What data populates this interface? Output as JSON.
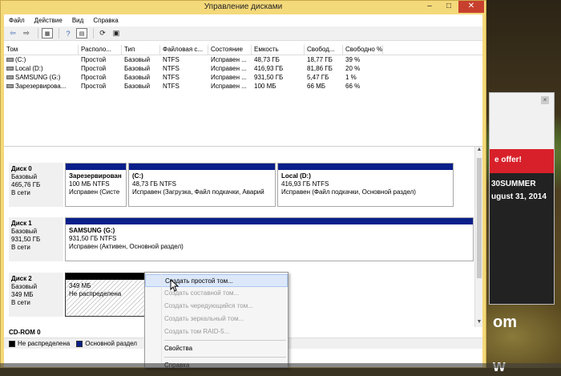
{
  "window": {
    "title": "Управление дисками",
    "min": "–",
    "max": "□",
    "close": "✕"
  },
  "menu": [
    "Файл",
    "Действие",
    "Вид",
    "Справка"
  ],
  "toolbar": [
    "back-icon",
    "forward-icon",
    "grid-icon",
    "help-icon",
    "properties-icon",
    "refresh-icon",
    "export-icon"
  ],
  "volumes": {
    "headers": [
      "Том",
      "Располо...",
      "Тип",
      "Файловая с...",
      "Состояние",
      "Емкость",
      "Свобод...",
      "Свободно %"
    ],
    "rows": [
      [
        "(C:)",
        "Простой",
        "Базовый",
        "NTFS",
        "Исправен ...",
        "48,73 ГБ",
        "18,77 ГБ",
        "39 %"
      ],
      [
        "Local (D:)",
        "Простой",
        "Базовый",
        "NTFS",
        "Исправен ...",
        "416,93 ГБ",
        "81,86 ГБ",
        "20 %"
      ],
      [
        "SAMSUNG (G:)",
        "Простой",
        "Базовый",
        "NTFS",
        "Исправен ...",
        "931,50 ГБ",
        "5,47 ГБ",
        "1 %"
      ],
      [
        "Зарезервирова...",
        "Простой",
        "Базовый",
        "NTFS",
        "Исправен ...",
        "100 МБ",
        "66 МБ",
        "66 %"
      ]
    ]
  },
  "disks": [
    {
      "name": "Диск 0",
      "type": "Базовый",
      "size": "465,76 ГБ",
      "status": "В сети",
      "parts": [
        {
          "name": "Зарезервирован",
          "size": "100 МБ NTFS",
          "state": "Исправен (Систе"
        },
        {
          "name": "(C:)",
          "size": "48,73 ГБ NTFS",
          "state": "Исправен (Загрузка, Файл подкачки, Аварий"
        },
        {
          "name": "Local  (D:)",
          "size": "416,93 ГБ NTFS",
          "state": "Исправен (Файл подкачки, Основной раздел)"
        }
      ]
    },
    {
      "name": "Диск 1",
      "type": "Базовый",
      "size": "931,50 ГБ",
      "status": "В сети",
      "parts": [
        {
          "name": "SAMSUNG  (G:)",
          "size": "931,50 ГБ NTFS",
          "state": "Исправен (Активен, Основной раздел)"
        }
      ]
    },
    {
      "name": "Диск 2",
      "type": "Базовый",
      "size": "349 МБ",
      "status": "В сети",
      "parts": [
        {
          "name": "349 МБ",
          "state": "Не распределена"
        }
      ]
    }
  ],
  "cdrom": "CD-ROM 0",
  "legend": [
    {
      "label": "Не распределена",
      "color": "#000000"
    },
    {
      "label": "Основной раздел",
      "color": "#0a1f8a"
    }
  ],
  "context_menu": [
    {
      "label": "Создать простой том...",
      "enabled": true,
      "highlighted": true
    },
    {
      "label": "Создать составной том...",
      "enabled": false
    },
    {
      "label": "Создать чередующийся том...",
      "enabled": false
    },
    {
      "label": "Создать зеркальный том...",
      "enabled": false
    },
    {
      "label": "Создать том RAID-5...",
      "enabled": false
    },
    {
      "label": "Свойства",
      "enabled": true
    },
    {
      "label": "Справка",
      "enabled": true
    }
  ],
  "background_ad": {
    "line1": "e offer!",
    "line2": "30SUMMER",
    "line3": "ugust 31, 2014",
    "big1": "om",
    "big2": "w"
  }
}
